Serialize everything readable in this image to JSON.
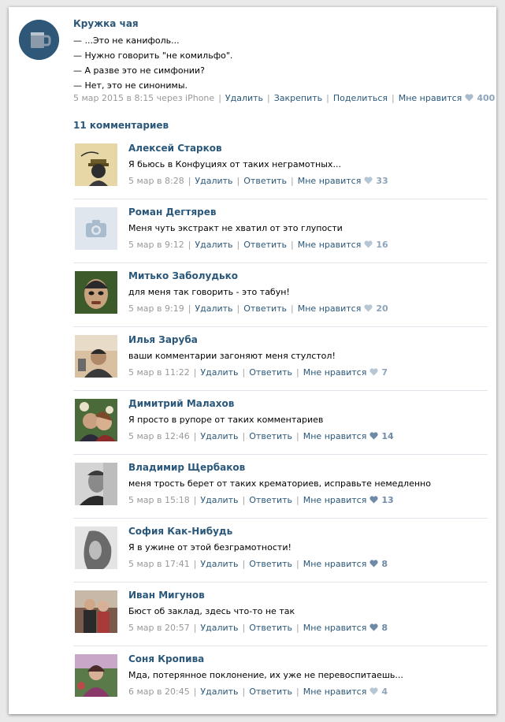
{
  "post": {
    "author": "Кружка чая",
    "lines": [
      "— ...Это не канифоль...",
      "— Нужно говорить \"не комильфо\".",
      "— А разве это не симфонии?",
      "— Нет, это не синонимы."
    ],
    "date": "5 мар 2015 в 8:15 через iPhone",
    "actions": {
      "delete": "Удалить",
      "pin": "Закрепить",
      "share": "Поделиться",
      "like": "Мне нравится"
    },
    "likes": "400"
  },
  "comments_header": "11 комментариев",
  "comments": [
    {
      "name": "Алексей Старков",
      "text": "Я бьюсь в Конфуциях от таких неграмотных...",
      "date": "5 мар в 8:28",
      "delete": "Удалить",
      "reply": "Ответить",
      "like": "Мне нравится",
      "likes": "33",
      "avatar": "avatar-illustration"
    },
    {
      "name": "Роман Дегтярев",
      "text": "Меня чуть экстракт не хватил от это глупости",
      "date": "5 мар в 9:12",
      "delete": "Удалить",
      "reply": "Ответить",
      "like": "Мне нравится",
      "likes": "16",
      "avatar": "camera-icon"
    },
    {
      "name": "Митько Заболудько",
      "text": "для меня так говорить - это табун!",
      "date": "5 мар в 9:19",
      "delete": "Удалить",
      "reply": "Ответить",
      "like": "Мне нравится",
      "likes": "20",
      "avatar": "avatar-photo"
    },
    {
      "name": "Илья Заруба",
      "text": "ваши комментарии загоняют меня стулстол!",
      "date": "5 мар в 11:22",
      "delete": "Удалить",
      "reply": "Ответить",
      "like": "Мне нравится",
      "likes": "7",
      "avatar": "avatar-photo"
    },
    {
      "name": "Димитрий Малахов",
      "text": "Я просто в рупоре от таких комментариев",
      "date": "5 мар в 12:46",
      "delete": "Удалить",
      "reply": "Ответить",
      "like": "Мне нравится",
      "likes": "14",
      "avatar": "avatar-photo"
    },
    {
      "name": "Владимир Щербаков",
      "text": "меня трость берет от таких крематориев, исправьте немедленно",
      "date": "5 мар в 15:18",
      "delete": "Удалить",
      "reply": "Ответить",
      "like": "Мне нравится",
      "likes": "13",
      "avatar": "avatar-photo"
    },
    {
      "name": "София Как-Нибудь",
      "text": "Я в ужине от этой безграмотности!",
      "date": "5 мар в 17:41",
      "delete": "Удалить",
      "reply": "Ответить",
      "like": "Мне нравится",
      "likes": "8",
      "avatar": "avatar-photo"
    },
    {
      "name": "Иван Мигунов",
      "text": "Бюст об заклад, здесь что-то не так",
      "date": "5 мар в 20:57",
      "delete": "Удалить",
      "reply": "Ответить",
      "like": "Мне нравится",
      "likes": "8",
      "avatar": "avatar-photo"
    },
    {
      "name": "Соня Кропива",
      "text": "Мда, потерянное поклонение, их уже не перевоспитаешь...",
      "date": "6 мар в 20:45",
      "delete": "Удалить",
      "reply": "Ответить",
      "like": "Мне нравится",
      "likes": "4",
      "avatar": "avatar-photo"
    }
  ],
  "colors": {
    "link": "#2b587a",
    "muted": "#999999",
    "like_count": "#8ea4bb",
    "divider": "#e1e5eb"
  }
}
